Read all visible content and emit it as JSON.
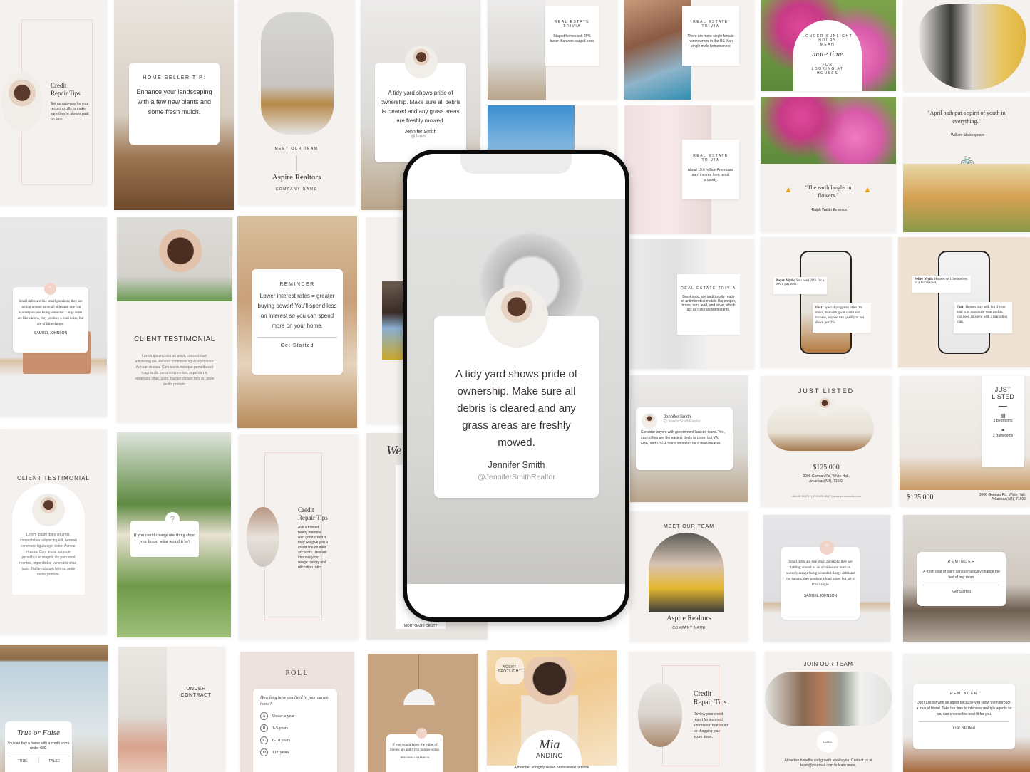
{
  "tiles": {
    "credit1": {
      "title_1": "Credit",
      "title_2": "Repair Tips",
      "body": "Set up auto-pay for your recurring bills to make sure they're always paid on time."
    },
    "seller_tip": {
      "heading": "HOME SELLER TIP:",
      "body": "Enhance your landscaping with a few new plants and some fresh mulch."
    },
    "team_story": {
      "label": "MEET OUR TEAM",
      "company": "Aspire Realtors",
      "sub": "COMPANY NAME"
    },
    "tidy_small": {
      "quote": "A tidy yard shows pride of ownership. Make sure all debris is cleared and any grass areas are freshly mowed.",
      "name": "Jennifer Smith",
      "handle": "@Jennif..."
    },
    "trivia1": {
      "label": "REAL ESTATE TRIVIA",
      "body": "Staged homes sell 25% faster than non-staged ones"
    },
    "trivia2": {
      "label": "REAL ESTATE TRIVIA",
      "body": "There are more single female homeowners in the US than single male homeowners"
    },
    "sunlight": {
      "arc": "LONGER SUNLIGHT HOURS",
      "mean": "MEAN",
      "script": "more time",
      "sub": "FOR LOOKING AT HOUSES"
    },
    "trivia3": {
      "label": "REAL ESTATE TRIVIA",
      "body": "About 10.6 million Americans earn income from rental property."
    },
    "emerson": {
      "quote": "\"The earth laughs in flowers.\"",
      "author": "- Ralph Waldo Emerson"
    },
    "shakespeare": {
      "quote": "\"April hath put a spirit of youth in everything.\"",
      "author": "- William Shakespeare"
    },
    "johnson1": {
      "quote": "Small debts are like small gunshots; they are rattling around us on all sides and one can scarcely escape being wounded. Large debts are like canons, they produce a loud noise, but are of little danger.",
      "author": "SAMUEL JOHNSON"
    },
    "testimonial1": {
      "title": "CLIENT TESTIMONIAL",
      "body": "Lorem ipsum dolor sit amet, consectetuer adipiscing elit. Aenean commodo ligula eget dolor. Aenean massa. Cum sociis natoque penatibus et magnis dis parturient montes, imperdiet a, venenatis vitae, justo. Nullam dictum felis eu pede mollis pretium."
    },
    "reminder1": {
      "label": "REMINDER",
      "body": "Lower interest rates = greater buying power! You'll spend less on interest so you can spend more on your home.",
      "cta": "Get Started"
    },
    "trivia4": {
      "label": "REAL ESTATE TRIVIA",
      "body": "Doorknobs are traditionally made of antimicrobial metals like copper, brass, iron, lead, and silver, which act as natural disinfectants."
    },
    "buyer_myth": {
      "myth_label": "Buyer Myth:",
      "myth": "You need 20% for a down payment.",
      "fact_label": "Fact:",
      "fact": "Special programs offer 0% down, but with good credit and income, anyone can qualify to put down just 3%."
    },
    "seller_myth": {
      "myth_label": "Seller Myth:",
      "myth": "Houses sell themselves in a hot market.",
      "fact_label": "Fact:",
      "fact": "Houses may sell, but if your goal is to maximize your profits, you need an agent with a marketing plan."
    },
    "jennifer_post": {
      "name": "Jennifer Smith",
      "handle": "@JenniferSmithRealtor",
      "body": "Consider buyers with government-backed loans. Yes, cash offers are the easiest deals to close, but VA, FHA, and USDA loans shouldn't be a deal-breaker."
    },
    "just_listed1": {
      "arc": "JUST LISTED",
      "price": "$125,000",
      "address": "3006 Gorman Rd, White Hall, Arkansas(AR), 71602",
      "footer": "HALLIE SMITH | 817-123-4567 | www.yourwebsite.com"
    },
    "just_listed2": {
      "title_1": "JUST",
      "title_2": "LISTED",
      "beds": "3 Bedrooms",
      "baths": "2 Bathrooms",
      "price": "$125,000",
      "address": "3006 Gorman Rd, White Hall, Arkansas(AR), 71602"
    },
    "testimonial2": {
      "arc": "CLIENT TESTIMONIAL",
      "body": "Lorem ipsum dolor sit amet, consectetuer adipiscing elit. Aenean commodo ligula eget dolor. Aenean massa. Cum sociis natoque penatibus et magnis dis parturient montes, imperdiet a, venenatis vitae, justo. Nullam dictum felis eu pede mollis pretium."
    },
    "question": {
      "mark": "?",
      "body": "If you could change one thing about your home, what would it be?"
    },
    "credit2": {
      "title_1": "Credit",
      "title_2": "Repair Tips",
      "body": "Ask a trusted family member with good credit if they will give you a credit line on their accounts. This will improve your usage history and utilization ratio."
    },
    "mortgage": {
      "script": "We",
      "label": "MORTGAGE DEBT?"
    },
    "team_post": {
      "arc": "MEET OUR TEAM",
      "company": "Aspire Realtors",
      "sub": "COMPANY NAME"
    },
    "johnson2": {
      "quote": "Small debts are like small gunshots; they are rattling around us on all sides and one can scarcely escape being wounded. Large debts are like canons, they produce a loud noise, but are of little danger.",
      "author": "SAMUEL JOHNSON"
    },
    "reminder2": {
      "label": "REMINDER",
      "body": "A fresh coat of paint can dramatically change the feel of any room.",
      "cta": "Get Started"
    },
    "true_false": {
      "script": "True or False",
      "body": "You can buy a home with a credit score under 600.",
      "true": "TRUE",
      "false": "FALSE"
    },
    "under_contract": {
      "line1": "UNDER",
      "line2": "CONTRACT"
    },
    "poll": {
      "title": "POLL",
      "question": "How long have you lived in your current home?",
      "options": [
        {
          "key": "A",
          "label": "Under a year"
        },
        {
          "key": "B",
          "label": "1-5 years"
        },
        {
          "key": "C",
          "label": "6-10 years"
        },
        {
          "key": "D",
          "label": "11+ years"
        }
      ]
    },
    "franklin": {
      "quote": "If you would know the value of money, go and try to borrow some.",
      "author": "BENJAMIN FRANKLIN"
    },
    "spotlight": {
      "badge": "AGENT SPOTLIGHT",
      "script": "Mia",
      "surname": "ANDINO",
      "tagline": "A member of highly skilled professional network"
    },
    "credit3": {
      "title_1": "Credit",
      "title_2": "Repair Tips",
      "body": "Review your credit report for incorrect information that could be dragging your score down."
    },
    "join": {
      "title": "JOIN OUR TEAM",
      "logo": "LOGO",
      "body": "Attractive benefits and growth awaits you. Contact us at team@yourmail.com to learn more."
    },
    "reminder3": {
      "label": "REMINDER",
      "body": "Don't just list with an agent because you know them through a mutual friend. Take the time to interview multiple agents so you can choose the best fit for you.",
      "cta": "Get Started"
    }
  },
  "phone": {
    "quote": "A tidy yard shows pride of ownership. Make sure all debris is cleared and any grass areas are freshly mowed.",
    "name": "Jennifer Smith",
    "handle": "@JenniferSmithRealtor"
  },
  "colors": {
    "background": "#f5f1ee",
    "accent_pink": "#f1d3c8",
    "text": "#3a3532",
    "beige": "#efe2d4"
  }
}
